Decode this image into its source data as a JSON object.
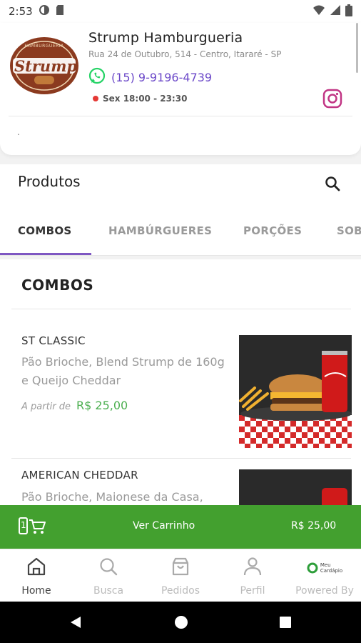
{
  "status_bar": {
    "time": "2:53"
  },
  "store": {
    "name": "Strump Hamburgueria",
    "address": "Rua 24 de Outubro, 514 - Centro, Itararé - SP",
    "phone": "(15) 9-9196-4739",
    "hours": "Sex 18:00 - 23:30",
    "extra": ".",
    "logo_text": "Strump",
    "logo_small_text": "HAMBURGUERIA",
    "status_color": "#e53935"
  },
  "products": {
    "title": "Produtos",
    "tabs": [
      {
        "label": "COMBOS",
        "active": true
      },
      {
        "label": "HAMBÚRGUERES",
        "active": false
      },
      {
        "label": "PORÇÕES",
        "active": false
      },
      {
        "label": "SOB",
        "active": false
      }
    ]
  },
  "section": {
    "title": "COMBOS",
    "items": [
      {
        "name": "ST CLASSIC",
        "description": "Pão Brioche, Blend Strump de 160g e Queijo Cheddar",
        "from_label": "A partir de",
        "price": "R$ 25,00",
        "image_icon": "burger-combo-photo"
      },
      {
        "name": "AMERICAN CHEDDAR",
        "description": "Pão Brioche, Maionese da Casa,",
        "image_icon": "burger-combo-photo"
      }
    ]
  },
  "cart": {
    "count": "1",
    "label": "Ver Carrinho",
    "total": "R$ 25,00",
    "color": "#43a02f"
  },
  "bottom_nav": {
    "items": [
      {
        "label": "Home",
        "icon": "home-icon"
      },
      {
        "label": "Busca",
        "icon": "search-icon"
      },
      {
        "label": "Pedidos",
        "icon": "bag-icon"
      },
      {
        "label": "Perfil",
        "icon": "user-icon"
      },
      {
        "label": "Powered By",
        "icon": "meu-cardapio-logo",
        "brand_line1": "Meu",
        "brand_line2": "Cardápio"
      }
    ]
  },
  "colors": {
    "accent_purple": "#7e57c2",
    "phone_purple": "#6c49c9",
    "price_green": "#4caf50",
    "whatsapp_green": "#25d366",
    "instagram": "#c13584"
  }
}
